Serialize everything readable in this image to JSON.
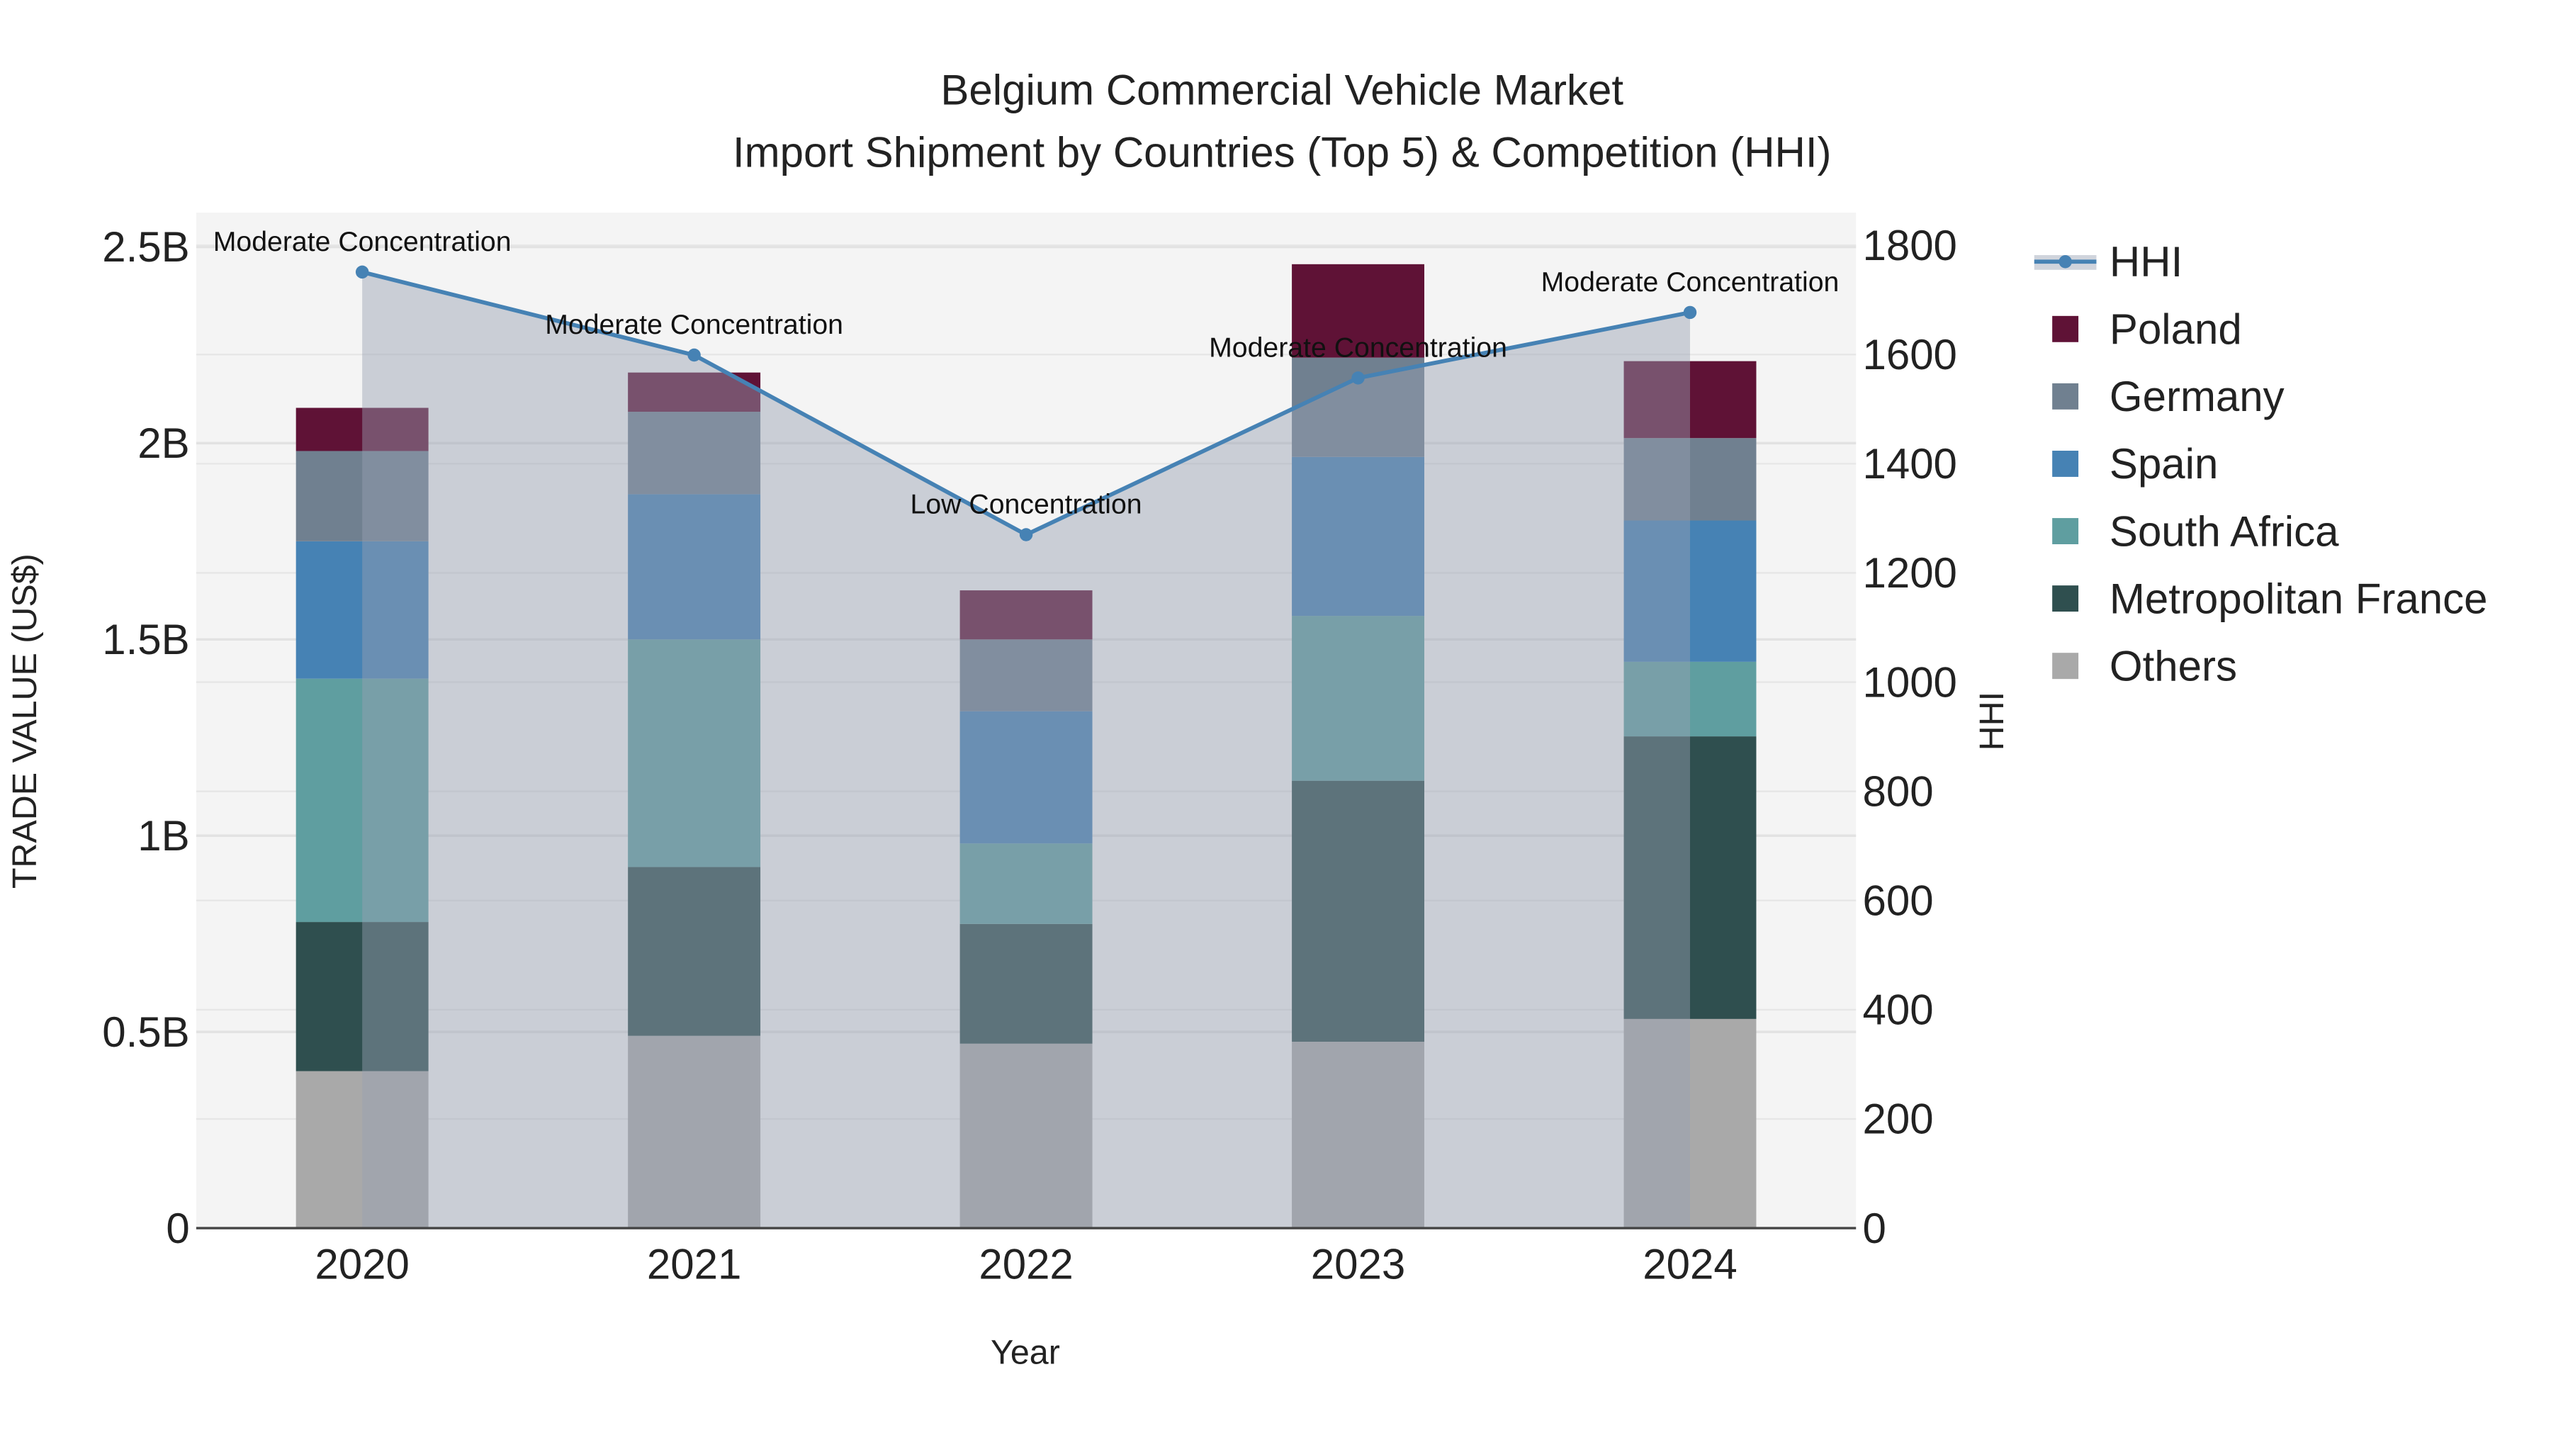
{
  "chart_data": {
    "type": "bar",
    "stacked": true,
    "title_line1": "Belgium Commercial Vehicle Market",
    "title_line2": "Import Shipment by Countries (Top 5) & Competition (HHI)",
    "xlabel": "Year",
    "ylabel": "TRADE VALUE (US$)",
    "y2label": "HHI",
    "categories": [
      "2020",
      "2021",
      "2022",
      "2023",
      "2024"
    ],
    "ylim": [
      0,
      2.58
    ],
    "yunit": "billion US$",
    "yticks": [
      0,
      0.5,
      1,
      1.5,
      2,
      2.5
    ],
    "ytick_labels": [
      "0",
      "0.5B",
      "1B",
      "1.5B",
      "2B",
      "2.5B"
    ],
    "y2lim": [
      0,
      1857
    ],
    "y2ticks": [
      0,
      200,
      400,
      600,
      800,
      1000,
      1200,
      1400,
      1600,
      1800
    ],
    "y2tick_labels": [
      "0",
      "200",
      "400",
      "600",
      "800",
      "1000",
      "1200",
      "1400",
      "1600",
      "1800"
    ],
    "grid": true,
    "legend_position": "right",
    "series": [
      {
        "name": "Others",
        "color": "#a9a9a9",
        "values": [
          0.4,
          0.49,
          0.47,
          0.475,
          0.533
        ]
      },
      {
        "name": "Metropolitan France",
        "color": "#2f4f4f",
        "values": [
          0.38,
          0.43,
          0.305,
          0.665,
          0.72
        ]
      },
      {
        "name": "South Africa",
        "color": "#5f9ea0",
        "values": [
          0.62,
          0.58,
          0.205,
          0.42,
          0.19
        ]
      },
      {
        "name": "Spain",
        "color": "#4682b4",
        "values": [
          0.35,
          0.37,
          0.337,
          0.405,
          0.36
        ]
      },
      {
        "name": "Germany",
        "color": "#708090",
        "values": [
          0.23,
          0.21,
          0.183,
          0.253,
          0.21
        ]
      },
      {
        "name": "Poland",
        "color": "#5f1236",
        "values": [
          0.11,
          0.1,
          0.125,
          0.238,
          0.196
        ]
      }
    ],
    "hhi": {
      "name": "HHI",
      "color": "#4682b4",
      "values": [
        1751,
        1599,
        1270,
        1557,
        1677
      ],
      "annotations": [
        "Moderate Concentration",
        "Moderate Concentration",
        "Low Concentration",
        "Moderate Concentration",
        "Moderate Concentration"
      ]
    },
    "legend_order": [
      "HHI",
      "Poland",
      "Germany",
      "Spain",
      "South Africa",
      "Metropolitan France",
      "Others"
    ]
  }
}
